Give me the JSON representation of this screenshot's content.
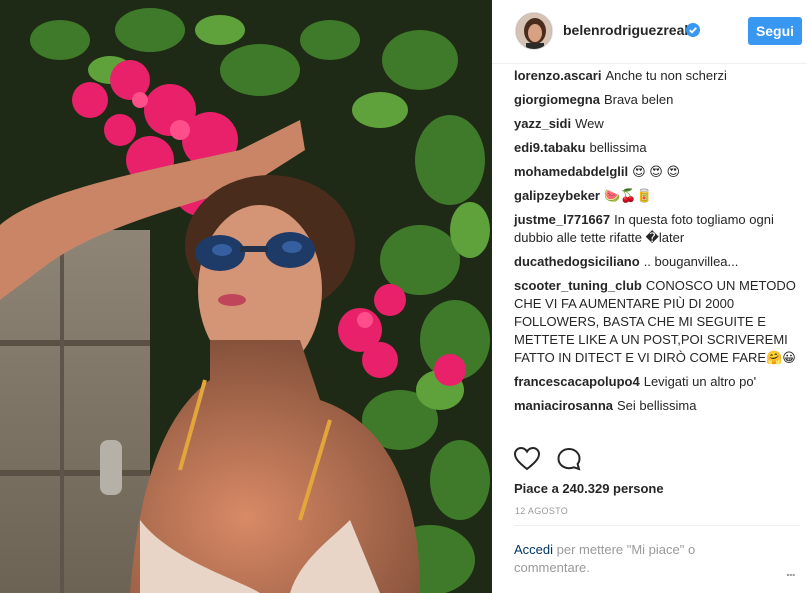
{
  "header": {
    "username": "belenrodriguezreal",
    "follow_label": "Segui",
    "accent": "#3897f0"
  },
  "comments": [
    {
      "user": "lorenzo.ascari",
      "text": "Anche tu non scherzi"
    },
    {
      "user": "giorgiomegna",
      "text": "Brava belen"
    },
    {
      "user": "yazz_sidi",
      "text": "Wew"
    },
    {
      "user": "edi9.tabaku",
      "text": "bellissima"
    },
    {
      "user": "mohamedabdelglil",
      "text": "😍 😍 😍"
    },
    {
      "user": "galipzeybeker",
      "text": "🍉🍒🥫"
    },
    {
      "user": "justme_l771667",
      "text": "In questa foto togliamo ogni dubbio alle tette rifatte �later"
    },
    {
      "user": "ducathedogsiciliano",
      "text": ".. bouganvillea..."
    },
    {
      "user": "scooter_tuning_club",
      "text": "CONOSCO UN METODO CHE VI FA AUMENTARE PIÙ DI 2000 FOLLOWERS, BASTA CHE MI SEGUITE E METTETE LIKE A UN POST,POI SCRIVEREMI FATTO IN DITECT E VI DIRÒ COME FARE🤗😀"
    },
    {
      "user": "francescacapolupo4",
      "text": "Levigati un altro po'"
    },
    {
      "user": "maniacirosanna",
      "text": "Sei bellissima"
    }
  ],
  "actions": {
    "like_icon": "heart-icon",
    "comment_icon": "speech-bubble-icon"
  },
  "likes": "Piace a 240.329 persone",
  "date": "12 AGOSTO",
  "login": {
    "link": "Accedi",
    "rest": "per mettere \"Mi piace\" o commentare."
  },
  "more_label": "..."
}
